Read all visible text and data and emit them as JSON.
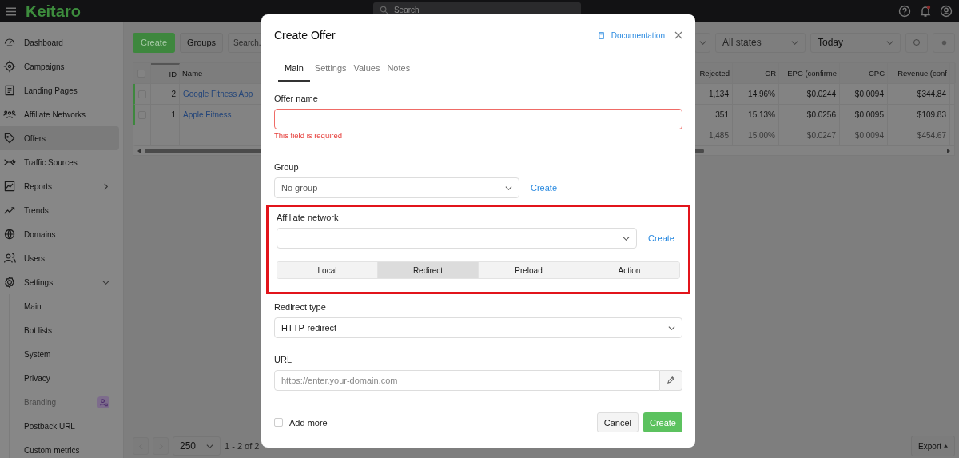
{
  "topbar": {
    "logo": "Keitaro",
    "search": {
      "placeholder": "Search"
    }
  },
  "sidebar": {
    "items": [
      {
        "label": "Dashboard",
        "selected": false
      },
      {
        "label": "Campaigns",
        "selected": false
      },
      {
        "label": "Landing Pages",
        "selected": false
      },
      {
        "label": "Affiliate Networks",
        "selected": false
      },
      {
        "label": "Offers",
        "selected": true
      },
      {
        "label": "Traffic Sources",
        "selected": false
      },
      {
        "label": "Reports",
        "selected": false,
        "expanded": false
      },
      {
        "label": "Trends",
        "selected": false
      },
      {
        "label": "Domains",
        "selected": false
      },
      {
        "label": "Users",
        "selected": false
      },
      {
        "label": "Settings",
        "selected": false,
        "expanded": true,
        "children": [
          {
            "label": "Main",
            "disabled": false
          },
          {
            "label": "Bot lists",
            "disabled": false
          },
          {
            "label": "System",
            "disabled": false
          },
          {
            "label": "Privacy",
            "disabled": false
          },
          {
            "label": "Branding",
            "disabled": true
          },
          {
            "label": "Postback URL",
            "disabled": false
          },
          {
            "label": "Custom metrics",
            "disabled": false
          }
        ]
      }
    ]
  },
  "toolbar": {
    "create": "Create",
    "groups": "Groups",
    "search": {
      "placeholder": "Search."
    },
    "filters": [
      {
        "value": "All states"
      },
      {
        "value": "Today"
      }
    ]
  },
  "table": {
    "select_all": {
      "checked": false
    },
    "columns": [
      "ID",
      "Name",
      "Rejected",
      "CR",
      "EPC (confirme",
      "CPC",
      "Revenue (conf"
    ],
    "rows": [
      {
        "checked": false,
        "active": true,
        "id": "2",
        "name": "Google Fitness App",
        "values": [
          "1,134",
          "14.96%",
          "$0.0244",
          "$0.0094",
          "$344.84"
        ]
      },
      {
        "checked": false,
        "active": true,
        "id": "1",
        "name": "Apple Fitness",
        "values": [
          "351",
          "15.13%",
          "$0.0256",
          "$0.0095",
          "$109.83"
        ]
      }
    ],
    "totals": [
      "1,485",
      "15.00%",
      "$0.0247",
      "$0.0094",
      "$454.67"
    ]
  },
  "footer": {
    "page_size": "250",
    "range": "1 - 2 of 2",
    "export": "Export"
  },
  "modal": {
    "title": "Create Offer",
    "documentation": "Documentation",
    "tabs": [
      {
        "label": "Main",
        "selected": true
      },
      {
        "label": "Settings",
        "selected": false
      },
      {
        "label": "Values",
        "selected": false
      },
      {
        "label": "Notes",
        "selected": false
      }
    ],
    "offer_name": {
      "label": "Offer name",
      "error": "This field is required"
    },
    "group": {
      "label": "Group",
      "value": "No group",
      "create": "Create"
    },
    "affiliate_network": {
      "label": "Affiliate network",
      "create": "Create",
      "highlighted": true
    },
    "modes": [
      {
        "label": "Local",
        "selected": false
      },
      {
        "label": "Redirect",
        "selected": true
      },
      {
        "label": "Preload",
        "selected": false
      },
      {
        "label": "Action",
        "selected": false
      }
    ],
    "redirect_type": {
      "label": "Redirect type",
      "value": "HTTP-redirect"
    },
    "url": {
      "label": "URL",
      "placeholder": "https://enter.your-domain.com"
    },
    "add_more": {
      "label": "Add more",
      "checked": false
    },
    "buttons": {
      "cancel": "Cancel",
      "create": "Create"
    }
  }
}
